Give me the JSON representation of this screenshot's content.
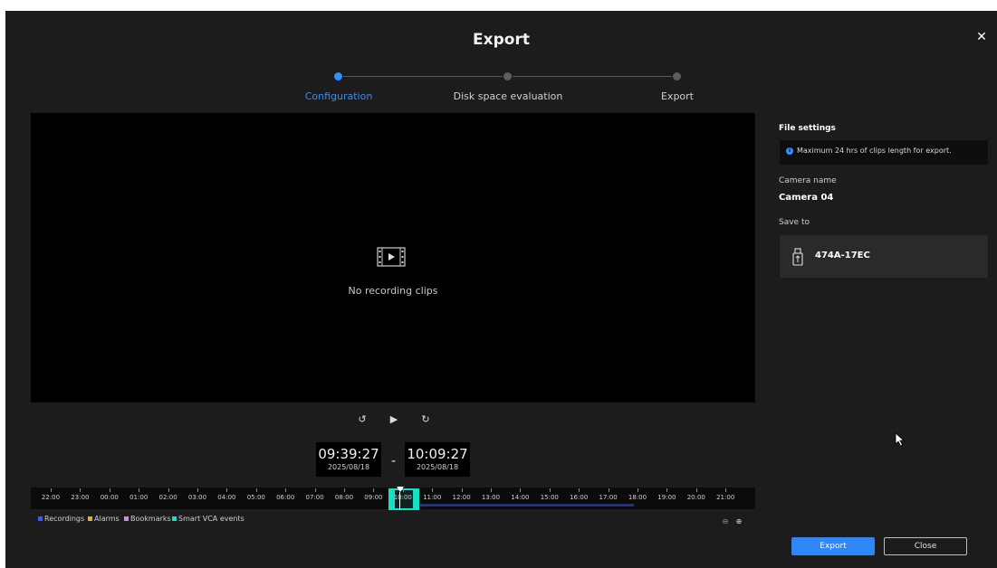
{
  "dialog": {
    "title": "Export",
    "close_icon": "close-icon"
  },
  "stepper": {
    "steps": [
      {
        "label": "Configuration",
        "active": true
      },
      {
        "label": "Disk space evaluation",
        "active": false
      },
      {
        "label": "Export",
        "active": false
      }
    ]
  },
  "preview": {
    "icon": "film-play-icon",
    "empty_text": "No recording clips"
  },
  "playback": {
    "rewind_icon": "rewind-10-icon",
    "play_icon": "play-icon",
    "forward_icon": "forward-10-icon"
  },
  "range": {
    "start": {
      "time": "09:39:27",
      "date": "2025/08/18"
    },
    "separator": "-",
    "end": {
      "time": "10:09:27",
      "date": "2025/08/18"
    }
  },
  "timeline": {
    "hours": [
      "22:00",
      "23:00",
      "00:00",
      "01:00",
      "02:00",
      "03:00",
      "04:00",
      "05:00",
      "06:00",
      "07:00",
      "08:00",
      "09:00",
      "10:00",
      "11:00",
      "12:00",
      "13:00",
      "14:00",
      "15:00",
      "16:00",
      "17:00",
      "18:00",
      "19:00",
      "20:00",
      "21:00"
    ]
  },
  "legend": [
    {
      "label": "Recordings",
      "color": "#3b5bff"
    },
    {
      "label": "Alarms",
      "color": "#f5a623"
    },
    {
      "label": "Bookmarks",
      "color": "#c78be8"
    },
    {
      "label": "Smart VCA events",
      "color": "#14e0c5"
    }
  ],
  "zoom": {
    "zoom_out_icon": "zoom-out-icon",
    "zoom_in_icon": "zoom-in-icon"
  },
  "file_settings": {
    "title": "File settings",
    "info": "Maximum 24 hrs of clips length for export.",
    "camera_name_label": "Camera name",
    "camera_name": "Camera 04",
    "save_to_label": "Save to",
    "device_icon": "usb-drive-icon",
    "device": "474A-17EC"
  },
  "buttons": {
    "export": "Export",
    "close": "Close"
  },
  "colors": {
    "accent": "#2f86f6",
    "selection": "#14e0c5"
  }
}
